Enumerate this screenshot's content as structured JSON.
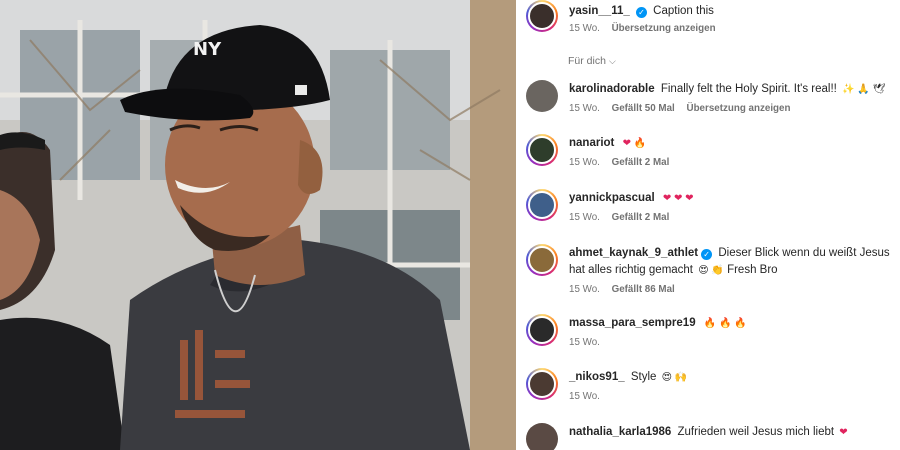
{
  "post": {
    "author": "yasin__11_",
    "caption": "Caption this",
    "age": "15 Wo.",
    "translate": "Übersetzung anzeigen"
  },
  "filter": {
    "label": "Für dich",
    "icon": "chevron-down-icon"
  },
  "comments": [
    {
      "user": "karolinadorable",
      "text": "Finally felt the Holy Spirit. It's real!!",
      "emojis": "✨ 🙏 🕊",
      "age": "15 Wo.",
      "likes": "Gefällt 50 Mal",
      "translate": "Übersetzung anzeigen"
    },
    {
      "user": "nanariot",
      "text": "",
      "emojis": "❤ 🔥",
      "age": "15 Wo.",
      "likes": "Gefällt 2 Mal"
    },
    {
      "user": "yannickpascual",
      "text": "",
      "emojis": "❤ ❤ ❤",
      "age": "15 Wo.",
      "likes": "Gefällt 2 Mal"
    },
    {
      "user": "ahmet_kaynak_9_athlet",
      "text_before": "Dieser Blick wenn du weißt Jesus hat alles richtig gemacht",
      "emojis": "😍 👏",
      "text_after": "Fresh Bro",
      "age": "15 Wo.",
      "likes": "Gefällt 86 Mal"
    },
    {
      "user": "massa_para_sempre19",
      "text": "",
      "emojis": "🔥 🔥 🔥",
      "age": "15 Wo."
    },
    {
      "user": "_nikos91_",
      "text": "Style",
      "emojis": "😍 🙌",
      "age": "15 Wo."
    },
    {
      "user": "nathalia_karla1986",
      "text": "Zufrieden weil Jesus mich liebt",
      "emojis": "❤"
    }
  ],
  "colors": {
    "accent": "#0095f6",
    "meta": "#737373",
    "heart": "#e0245e"
  }
}
